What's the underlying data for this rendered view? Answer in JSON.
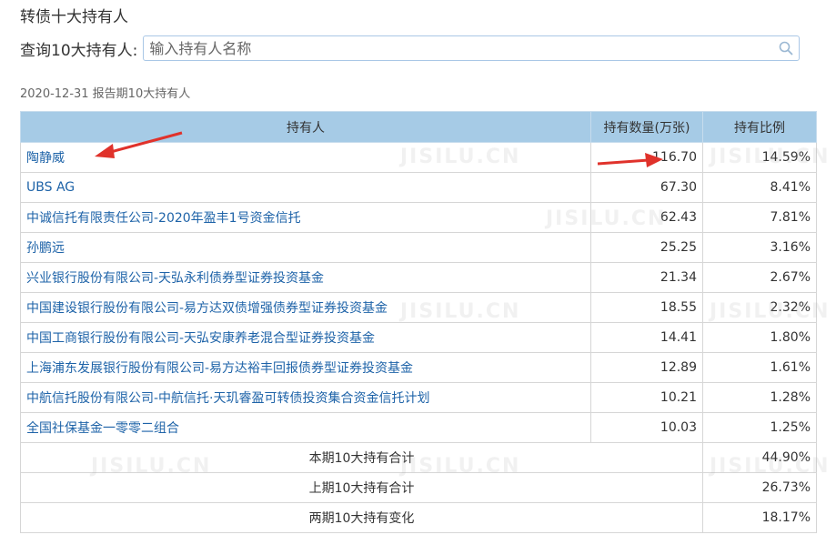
{
  "page_title": "转债十大持有人",
  "search": {
    "label": "查询10大持有人:",
    "placeholder": "输入持有人名称",
    "value": ""
  },
  "period_label": "2020-12-31 报告期10大持有人",
  "table": {
    "headers": [
      "持有人",
      "持有数量(万张)",
      "持有比例"
    ],
    "rows": [
      {
        "name": "陶静威",
        "qty": "116.70",
        "pct": "14.59%"
      },
      {
        "name": "UBS AG",
        "qty": "67.30",
        "pct": "8.41%"
      },
      {
        "name": "中诚信托有限责任公司-2020年盈丰1号资金信托",
        "qty": "62.43",
        "pct": "7.81%"
      },
      {
        "name": "孙鹏远",
        "qty": "25.25",
        "pct": "3.16%"
      },
      {
        "name": "兴业银行股份有限公司-天弘永利债券型证券投资基金",
        "qty": "21.34",
        "pct": "2.67%"
      },
      {
        "name": "中国建设银行股份有限公司-易方达双债增强债券型证券投资基金",
        "qty": "18.55",
        "pct": "2.32%"
      },
      {
        "name": "中国工商银行股份有限公司-天弘安康养老混合型证券投资基金",
        "qty": "14.41",
        "pct": "1.80%"
      },
      {
        "name": "上海浦东发展银行股份有限公司-易方达裕丰回报债券型证券投资基金",
        "qty": "12.89",
        "pct": "1.61%"
      },
      {
        "name": "中航信托股份有限公司-中航信托·天玑睿盈可转债投资集合资金信托计划",
        "qty": "10.21",
        "pct": "1.28%"
      },
      {
        "name": "全国社保基金一零零二组合",
        "qty": "10.03",
        "pct": "1.25%"
      }
    ],
    "summary": [
      {
        "label": "本期10大持有合计",
        "value": "44.90%"
      },
      {
        "label": "上期10大持有合计",
        "value": "26.73%"
      },
      {
        "label": "两期10大持有变化",
        "value": "18.17%"
      }
    ]
  },
  "colors": {
    "header_bg": "#a6cbe6",
    "link": "#1e63a8",
    "arrow": "#e0322b"
  },
  "icons": [
    "search-icon",
    "arrow-annotation"
  ]
}
